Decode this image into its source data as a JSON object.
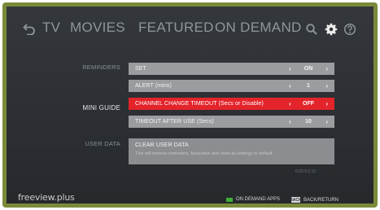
{
  "nav": {
    "tabs": [
      "TV",
      "MOVIES",
      "FEATURED",
      "ON DEMAND"
    ],
    "icons": [
      "back-icon",
      "search-icon",
      "settings-gear-icon",
      "help-icon"
    ]
  },
  "sections": {
    "reminders": "REMINDERS",
    "mini_guide": "MINI GUIDE",
    "user_data": "USER DATA"
  },
  "settings": [
    {
      "label": "SET",
      "value": "ON"
    },
    {
      "label": "ALERT (mins)",
      "value": "1"
    },
    {
      "label": "CHANNEL CHANGE TIMEOUT (Secs or Disable)",
      "value": "OFF",
      "selected": true
    },
    {
      "label": "TIMEOUT AFTER USE (Secs)",
      "value": "10"
    }
  ],
  "clear_user_data": {
    "title": "CLEAR USER DATA",
    "description": "This will remove reminders, favourites and reset all settings to default."
  },
  "version": "0.00.9.0.12",
  "footer": {
    "brand": "freeview.plus",
    "on_demand_apps": "ON DEMAND APPS",
    "back_key": "BACK",
    "back_return": "BACK/RETURN"
  },
  "colors": {
    "selected_row": "#e3242b",
    "row": "#9a9d9f",
    "green_key": "#3fae3a",
    "bezel": "#7a8a3a"
  }
}
